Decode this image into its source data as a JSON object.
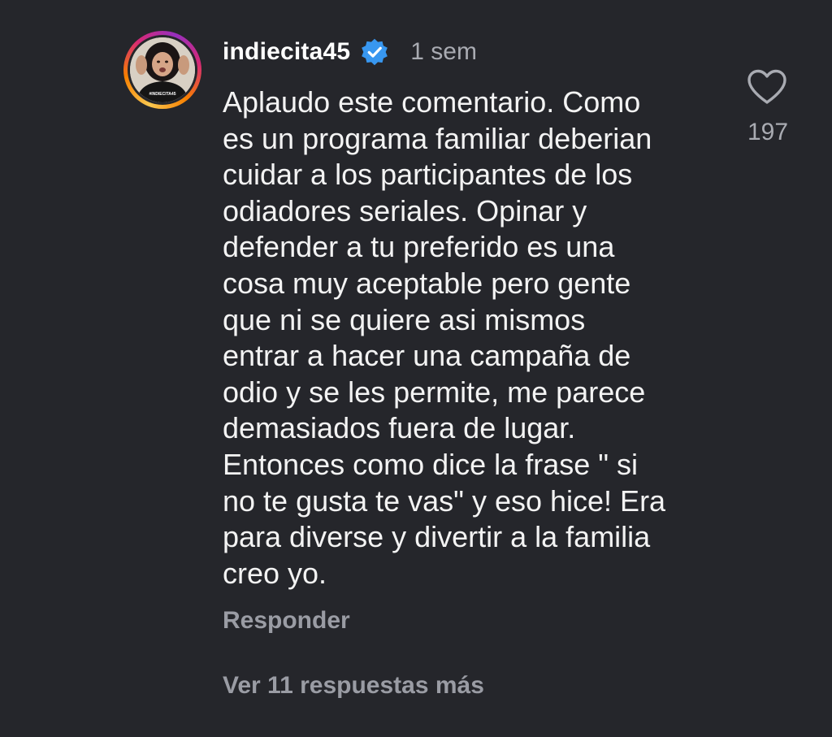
{
  "comment": {
    "username": "indiecita45",
    "verified": true,
    "time": "1 sem",
    "avatar_shirt_text": "#INDIECITA45",
    "lines": [
      "Aplaudo este comentario. Como",
      "es un programa familiar deberian",
      "cuidar a los participantes de los",
      "odiadores seriales. Opinar y",
      "defender a tu preferido es una",
      "cosa muy aceptable pero gente",
      "que ni se quiere asi mismos",
      "entrar a hacer una campaña de",
      "odio y se les permite, me parece",
      "demasiados fuera de lugar.",
      "Entonces como dice la frase \" si",
      "no te gusta te vas\" y eso hice! Era",
      "para diverse y divertir a la familia",
      "creo yo."
    ],
    "like_icon": "heart-icon",
    "like_count": "197",
    "reply_label": "Responder",
    "more_replies_label": "Ver 11 respuestas más"
  },
  "colors": {
    "background": "#25262b",
    "verified_badge": "#3897f0",
    "secondary_text": "#a9abb2"
  }
}
